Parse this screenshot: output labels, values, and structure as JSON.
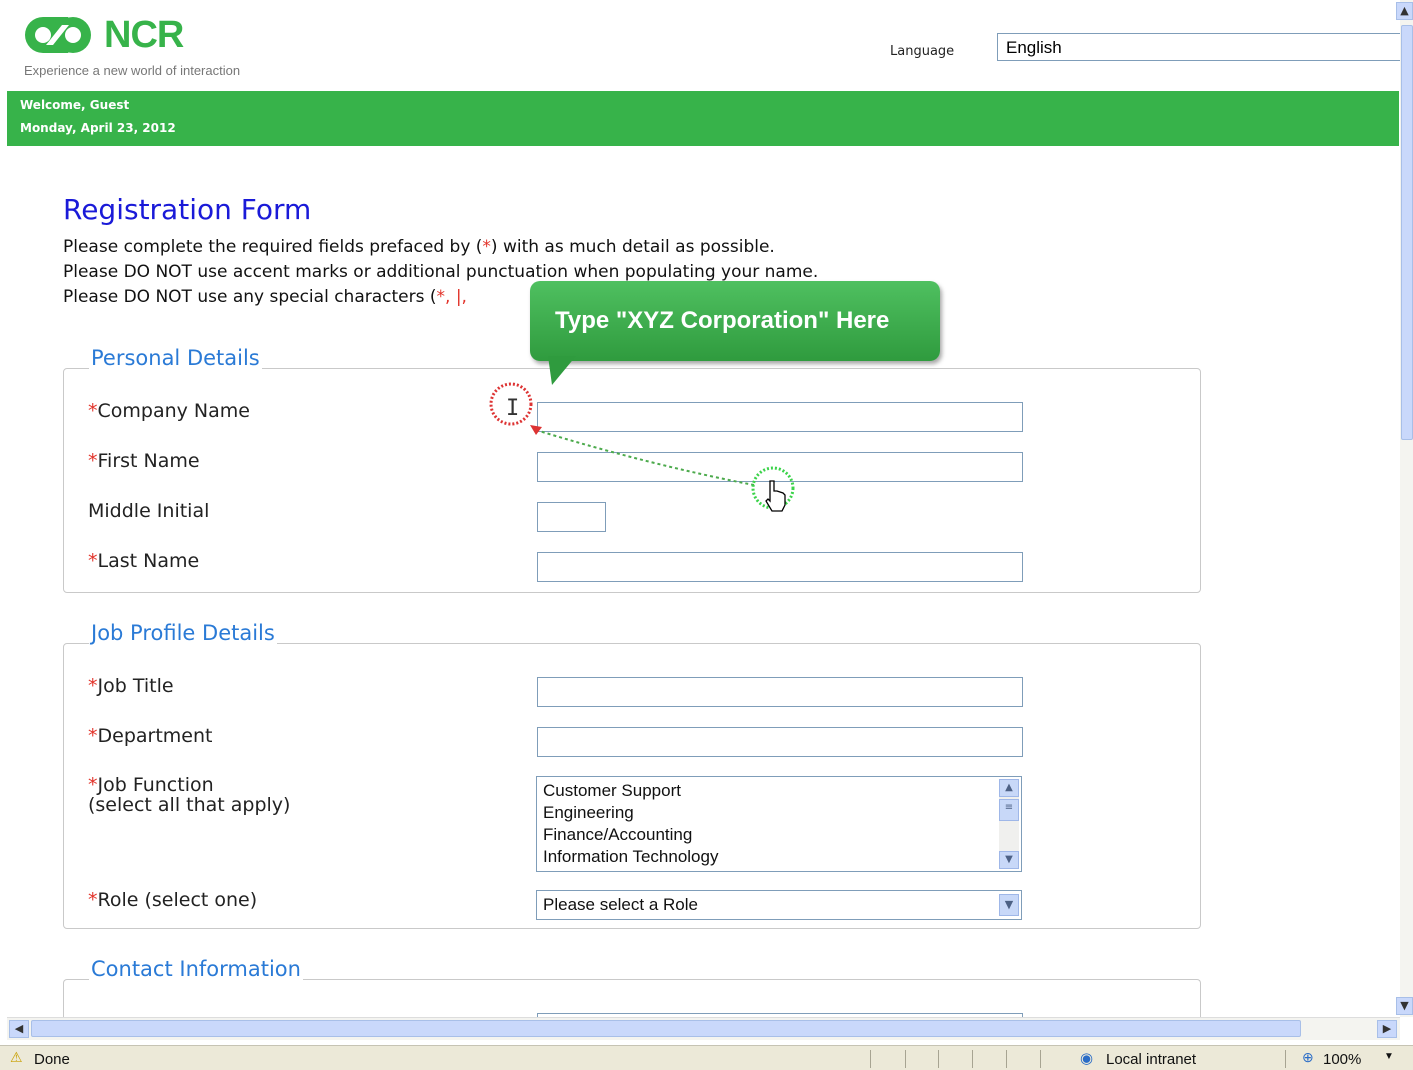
{
  "header": {
    "logo_text": "NCR",
    "tagline": "Experience a new world of interaction",
    "language_label": "Language",
    "language_value": "English",
    "welcome": "Welcome, Guest",
    "date": "Monday, April 23, 2012"
  },
  "form": {
    "title": "Registration Form",
    "intro_line1_a": "Please complete the required fields prefaced by (",
    "intro_line1_star": "*",
    "intro_line1_b": ") with as much detail as possible.",
    "intro_line2": "Please DO NOT use accent marks or additional punctuation when populating your name.",
    "intro_line3_a": "Please DO NOT use any special characters (",
    "intro_line3_chars": "*, |,",
    "required_mark": "*"
  },
  "personal": {
    "legend": "Personal Details",
    "company_label": "Company Name",
    "first_label": "First Name",
    "middle_label": "Middle Initial",
    "last_label": "Last Name"
  },
  "job": {
    "legend": "Job Profile Details",
    "title_label": "Job Title",
    "department_label": "Department",
    "function_label": "Job Function",
    "function_hint": "(select all that apply)",
    "function_options": [
      "Customer Support",
      "Engineering",
      "Finance/Accounting",
      "Information Technology"
    ],
    "role_label": "Role (select one)",
    "role_value": "Please select a Role"
  },
  "contact": {
    "legend": "Contact Information"
  },
  "callout": {
    "text": "Type \"XYZ Corporation\" Here"
  },
  "status": {
    "left": "Done",
    "zone": "Local intranet",
    "zoom": "100%"
  },
  "colors": {
    "brand_green": "#37b34a",
    "title_blue": "#1a1ad8",
    "legend_blue": "#2a7ad6",
    "required_red": "#e2332a"
  }
}
